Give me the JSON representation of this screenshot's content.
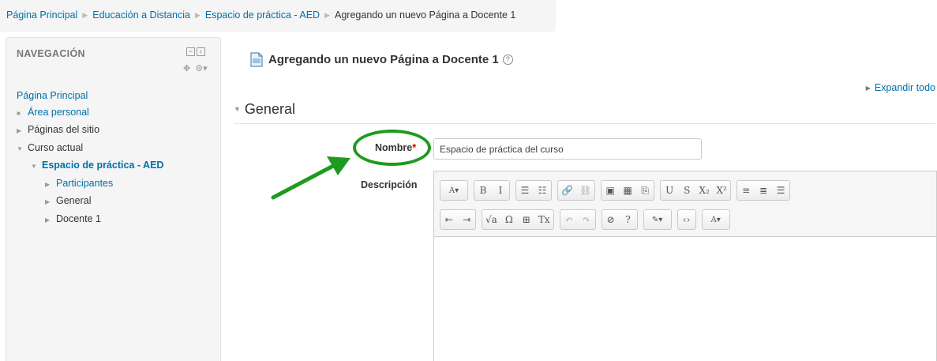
{
  "breadcrumb": {
    "items": [
      "Página Principal",
      "Educación a Distancia",
      "Espacio de práctica - AED"
    ],
    "current": "Agregando un nuevo Página a Docente 1",
    "separator": "▶"
  },
  "navigation": {
    "title": "NAVEGACIÓN",
    "home": "Página Principal",
    "area_personal": "Área personal",
    "paginas_sitio": "Páginas del sitio",
    "curso_actual": "Curso actual",
    "course": "Espacio de práctica - AED",
    "participantes": "Participantes",
    "general": "General",
    "docente": "Docente 1"
  },
  "main": {
    "title": "Agregando un nuevo Página a Docente 1",
    "help": "?",
    "expand_all": "Expandir todo",
    "section": "General",
    "nombre_label": "Nombre",
    "required_mark": "*",
    "nombre_value": "Espacio de práctica del curso",
    "descripcion_label": "Descripción"
  },
  "editor": {
    "row1": [
      [
        "A▾"
      ],
      [
        "B",
        "I"
      ],
      [
        "☰",
        "☷"
      ],
      [
        "🔗",
        "⛓"
      ],
      [
        "▣",
        "▦",
        "⎘"
      ],
      [
        "U",
        "S",
        "X₂",
        "X²"
      ],
      [
        "≡",
        "≣",
        "☰"
      ]
    ],
    "row2": [
      [
        "⇤",
        "⇥"
      ],
      [
        "√a",
        "Ω",
        "⊞",
        "Tx"
      ],
      [
        "↶",
        "↷"
      ],
      [
        "⊘",
        "?"
      ],
      [
        "✎▾"
      ],
      [
        "‹›"
      ],
      [
        "A▾"
      ]
    ]
  },
  "colors": {
    "link": "#0070a8",
    "annotation_green": "#1e9b1e",
    "required": "#cc0000"
  }
}
